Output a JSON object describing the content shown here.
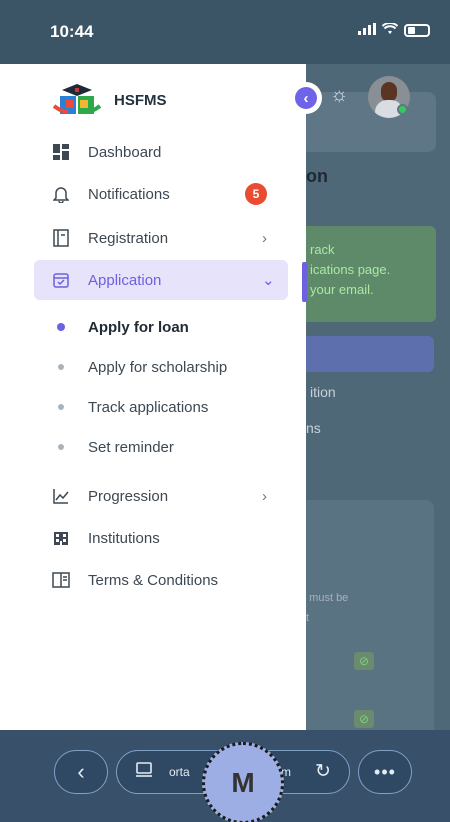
{
  "status_bar": {
    "time": "10:44",
    "signal_icon": "signal-bars-icon",
    "wifi_icon": "wifi-icon",
    "battery_icon": "battery-icon"
  },
  "brand": {
    "name": "HSFMS",
    "logo_icon": "graduation-cap-hands-logo"
  },
  "header": {
    "collapse_icon": "chevron-left-icon",
    "theme_icon": "sun-icon",
    "avatar_icon": "user-avatar"
  },
  "nav": {
    "items": [
      {
        "label": "Dashboard",
        "icon": "dashboard-grid-icon"
      },
      {
        "label": "Notifications",
        "icon": "bell-icon",
        "badge": "5"
      },
      {
        "label": "Registration",
        "icon": "document-icon",
        "chevron": "›"
      },
      {
        "label": "Application",
        "icon": "calendar-check-icon",
        "chevron": "⌄",
        "active": true
      },
      {
        "label": "Progression",
        "icon": "line-chart-icon",
        "chevron": "›"
      },
      {
        "label": "Institutions",
        "icon": "building-icon"
      },
      {
        "label": "Terms & Conditions",
        "icon": "book-icon"
      }
    ],
    "application_sub": [
      {
        "label": "Apply for loan",
        "current": true
      },
      {
        "label": "Apply for scholarship"
      },
      {
        "label": "Track applications"
      },
      {
        "label": "Set reminder"
      }
    ]
  },
  "background_page": {
    "title_fragment": "on",
    "alert_lines": [
      "rack",
      "ications page.",
      "your email."
    ],
    "text1": "ition",
    "text2": "ns",
    "text3": "u must be",
    "text4": "t"
  },
  "browser_bar": {
    "url_left": "orta",
    "url_right": "zm",
    "back_icon": "chevron-left-icon",
    "tabs_icon": "tabs-icon",
    "reload_icon": "reload-icon",
    "more_icon": "more-dots-icon"
  },
  "overlay_badge": "M",
  "colors": {
    "accent": "#6c61e0",
    "active_bg": "#e6e3fb",
    "badge": "#ea4c32",
    "status_bar": "#3c5566"
  }
}
